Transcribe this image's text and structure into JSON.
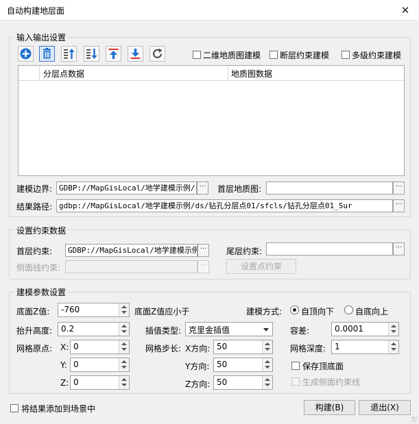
{
  "window": {
    "title": "自动构建地层面",
    "close_glyph": "✕"
  },
  "io": {
    "legend": "输入输出设置",
    "toolbar": {
      "tools": [
        "add-icon",
        "delete-icon",
        "move-up-icon",
        "move-down-icon",
        "move-top-icon",
        "move-bottom-icon",
        "refresh-icon"
      ],
      "colors": {
        "blue": "#1f6fd1",
        "red": "#d9382f"
      }
    },
    "options": [
      {
        "label": "二维地质图建模",
        "checked": false
      },
      {
        "label": "断层约束建模",
        "checked": false
      },
      {
        "label": "多级约束建模",
        "checked": false
      }
    ],
    "grid": {
      "columns": [
        "分层点数据",
        "地质图数据"
      ],
      "rows": []
    },
    "boundary": {
      "label": "建模边界:",
      "value": "GDBP://MapGisLocal/地学建模示例/s",
      "button": "···"
    },
    "first_map": {
      "label": "首层地质图:",
      "value": "",
      "button": "···"
    },
    "result_path": {
      "label": "结果路径:",
      "value": "gdbp://MapGisLocal/地学建模示例/ds/钻孔分层点01/sfcls/钻孔分层点01_Sur",
      "button": "···"
    }
  },
  "constraint": {
    "legend": "设置约束数据",
    "first_layer": {
      "label": "首层约束:",
      "value": "GDBP://MapGisLocal/地学建模示例",
      "button": "···"
    },
    "last_layer": {
      "label": "尾层约束:",
      "value": "",
      "button": "···"
    },
    "side_line": {
      "label": "侧面线约束:",
      "value": "",
      "button": "···"
    },
    "set_point_button": "设置点约束"
  },
  "params": {
    "legend": "建模参数设置",
    "base_z": {
      "label": "底面Z值:",
      "value": "-760",
      "hint": "底面Z值应小于"
    },
    "method": {
      "label": "建模方式:",
      "options": [
        "自顶向下",
        "自底向上"
      ],
      "selected": "自顶向下"
    },
    "lift_height": {
      "label": "抬升高度:",
      "value": "0.2"
    },
    "interp": {
      "label": "插值类型:",
      "value": "克里金插值"
    },
    "tolerance": {
      "label": "容差:",
      "value": "0.0001"
    },
    "grid_origin": {
      "label": "网格原点:",
      "x_label": "X:",
      "x": "0",
      "y_label": "Y:",
      "y": "0",
      "z_label": "Z:",
      "z": "0"
    },
    "grid_step": {
      "label": "网格步长:",
      "x_label": "X方向:",
      "x": "50",
      "y_label": "Y方向:",
      "y": "50",
      "z_label": "Z方向:",
      "z": "50"
    },
    "grid_depth": {
      "label": "网格深度:",
      "value": "1"
    },
    "save_top": {
      "label": "保存顶底面",
      "checked": false
    },
    "gen_side": {
      "label": "生成侧面约束线",
      "checked": false,
      "enabled": false
    }
  },
  "footer": {
    "add_to_scene": {
      "label": "将结果添加到场景中",
      "checked": false
    },
    "build_button": "构建(B)",
    "exit_button": "退出(X)"
  }
}
